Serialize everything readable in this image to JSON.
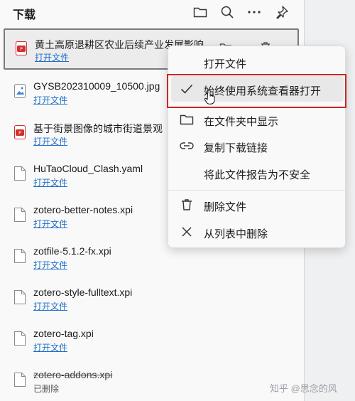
{
  "header": {
    "title": "下载",
    "icons": [
      "folder-icon",
      "search-icon",
      "more-icon",
      "pin-icon"
    ]
  },
  "items": [
    {
      "name": "黄土高原退耕区农业后续产业发展影响",
      "action": "打开文件",
      "type": "pdf"
    },
    {
      "name": "GYSB202310009_10500.jpg",
      "action": "打开文件",
      "type": "image"
    },
    {
      "name": "基于街景图像的城市街道景观",
      "action": "打开文件",
      "type": "pdf"
    },
    {
      "name": "HuTaoCloud_Clash.yaml",
      "action": "打开文件",
      "type": "file"
    },
    {
      "name": "zotero-better-notes.xpi",
      "action": "打开文件",
      "type": "file"
    },
    {
      "name": "zotfile-5.1.2-fx.xpi",
      "action": "打开文件",
      "type": "file"
    },
    {
      "name": "zotero-style-fulltext.xpi",
      "action": "打开文件",
      "type": "file"
    },
    {
      "name": "zotero-tag.xpi",
      "action": "打开文件",
      "type": "file"
    },
    {
      "name": "zotero-addons.xpi",
      "status": "已删除",
      "type": "file"
    }
  ],
  "menu": {
    "open_file": "打开文件",
    "always_open_system_viewer": "始终使用系统查看器打开",
    "show_in_folder": "在文件夹中显示",
    "copy_download_link": "复制下载链接",
    "report_unsafe": "将此文件报告为不安全",
    "delete_file": "删除文件",
    "remove_from_list": "从列表中删除"
  },
  "watermark": "知乎 @思念的风",
  "colors": {
    "link": "#1f6ec9",
    "highlight_border": "#c62828",
    "pdf_red": "#d32f2f"
  }
}
